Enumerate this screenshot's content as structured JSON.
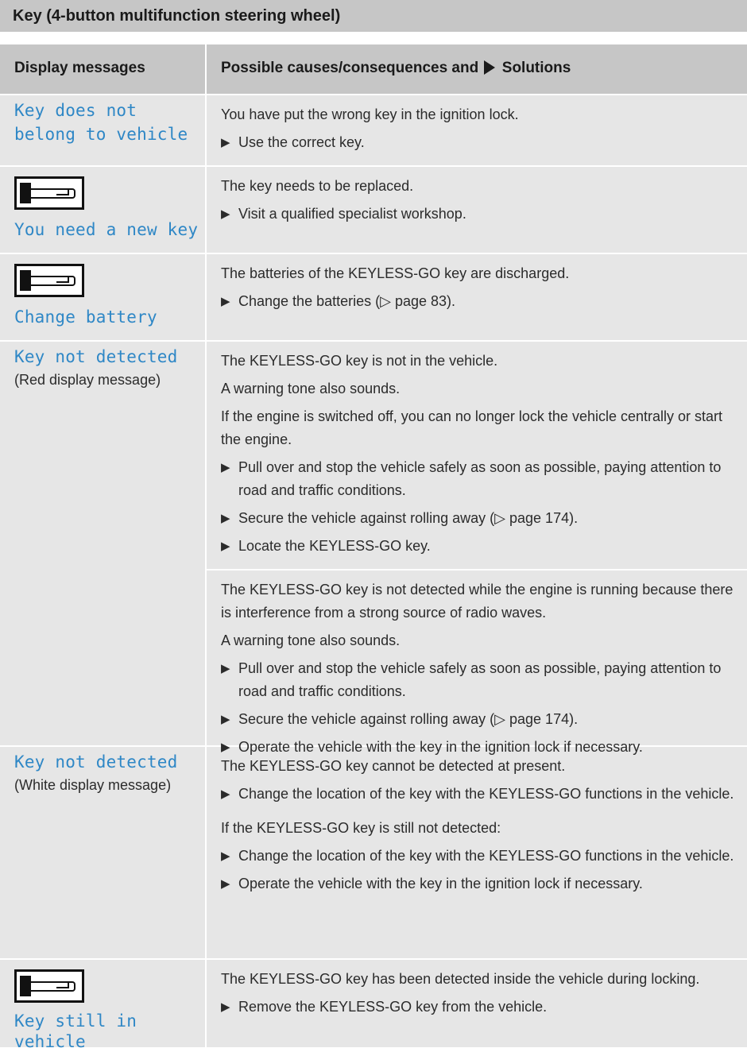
{
  "section_title": "Key (4-button multifunction steering wheel)",
  "header": {
    "left": "Display messages",
    "right_prefix": "Possible causes/consequences and",
    "right_suffix": "Solutions"
  },
  "step_marker": "▶",
  "rows": [
    {
      "message": "Key does not belong to vehicle",
      "texts": [
        "You have put the wrong key in the ignition lock."
      ],
      "steps": [
        "Use the correct key."
      ]
    },
    {
      "message": "You need a new key",
      "icon": "key-icon",
      "texts": [
        "The key needs to be replaced."
      ],
      "steps": [
        "Visit a qualified specialist workshop."
      ]
    },
    {
      "message": "Change battery",
      "icon": "key-icon",
      "texts": [
        "The batteries of the KEYLESS-GO key are discharged."
      ],
      "steps": [
        "Change the batteries (▷ page 83)."
      ]
    },
    {
      "message": "Key not detected",
      "subtitle": "(Red display message)",
      "block1": {
        "texts": [
          "The KEYLESS-GO key is not in the vehicle.",
          "A warning tone also sounds.",
          "If the engine is switched off, you can no longer lock the vehicle centrally or start the engine."
        ],
        "steps": [
          "Pull over and stop the vehicle safely as soon as possible, paying attention to road and traffic conditions.",
          "Secure the vehicle against rolling away (▷ page 174).",
          "Locate the KEYLESS-GO key."
        ]
      },
      "block2": {
        "texts": [
          "The KEYLESS-GO key is not detected while the engine is running because there is interference from a strong source of radio waves.",
          "A warning tone also sounds."
        ],
        "steps": [
          "Pull over and stop the vehicle safely as soon as possible, paying attention to road and traffic conditions.",
          "Secure the vehicle against rolling away (▷ page 174).",
          "Operate the vehicle with the key in the ignition lock if necessary."
        ]
      }
    },
    {
      "message": "Key not detected",
      "subtitle": "(White display message)",
      "text1": "The KEYLESS-GO key cannot be detected at present.",
      "step1": "Change the location of the key with the KEYLESS-GO functions in the vehicle.",
      "text2": "If the KEYLESS-GO key is still not detected:",
      "steps2": [
        "Change the location of the key with the KEYLESS-GO functions in the vehicle.",
        "Operate the vehicle with the key in the ignition lock if necessary."
      ]
    },
    {
      "message": "Key still in vehicle",
      "icon": "key-icon",
      "texts": [
        "The KEYLESS-GO key has been detected inside the vehicle during locking."
      ],
      "steps": [
        "Remove the KEYLESS-GO key from the vehicle."
      ]
    }
  ]
}
